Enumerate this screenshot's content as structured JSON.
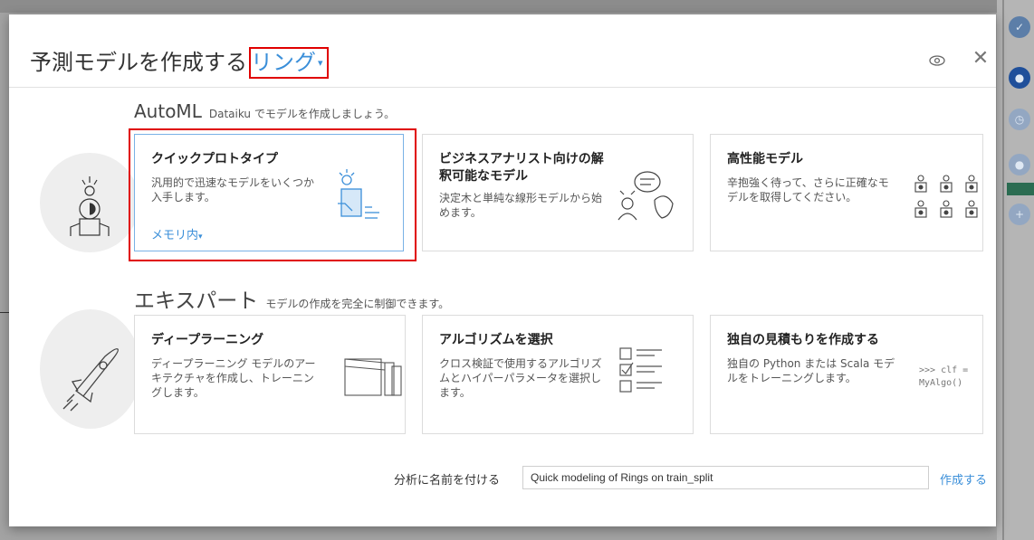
{
  "modal": {
    "title": "予測モデルを作成する",
    "target_dropdown": "リング"
  },
  "automl": {
    "heading": "AutoML",
    "subheading": "Dataiku でモデルを作成しましょう。",
    "cards": [
      {
        "title": "クイックプロトタイプ",
        "description": "汎用的で迅速なモデルをいくつか入手します。",
        "backend_label": "メモリ内"
      },
      {
        "title": "ビジネスアナリスト向けの解釈可能なモデル",
        "description": "決定木と単純な線形モデルから始めます。"
      },
      {
        "title": "高性能モデル",
        "description": "辛抱強く待って、さらに正確なモデルを取得してください。"
      }
    ]
  },
  "expert": {
    "heading": "エキスパート",
    "subheading": "モデルの作成を完全に制御できます。",
    "cards": [
      {
        "title": "ディープラーニング",
        "description": "ディープラーニング モデルのアーキテクチャを作成し、トレーニングします。"
      },
      {
        "title": "アルゴリズムを選択",
        "description": "クロス検証で使用するアルゴリズムとハイパーパラメータを選択します。"
      },
      {
        "title": "独自の見積もりを作成する",
        "description": "独自の Python または Scala モデルをトレーニングします。",
        "code_snippet": ">>> clf = MyAlgo()"
      }
    ]
  },
  "footer": {
    "name_label": "分析に名前を付ける",
    "name_value": "Quick modeling of Rings on train_split",
    "create_label": "作成する"
  },
  "colors": {
    "accent": "#3b8fd9",
    "highlight": "#e00000"
  }
}
